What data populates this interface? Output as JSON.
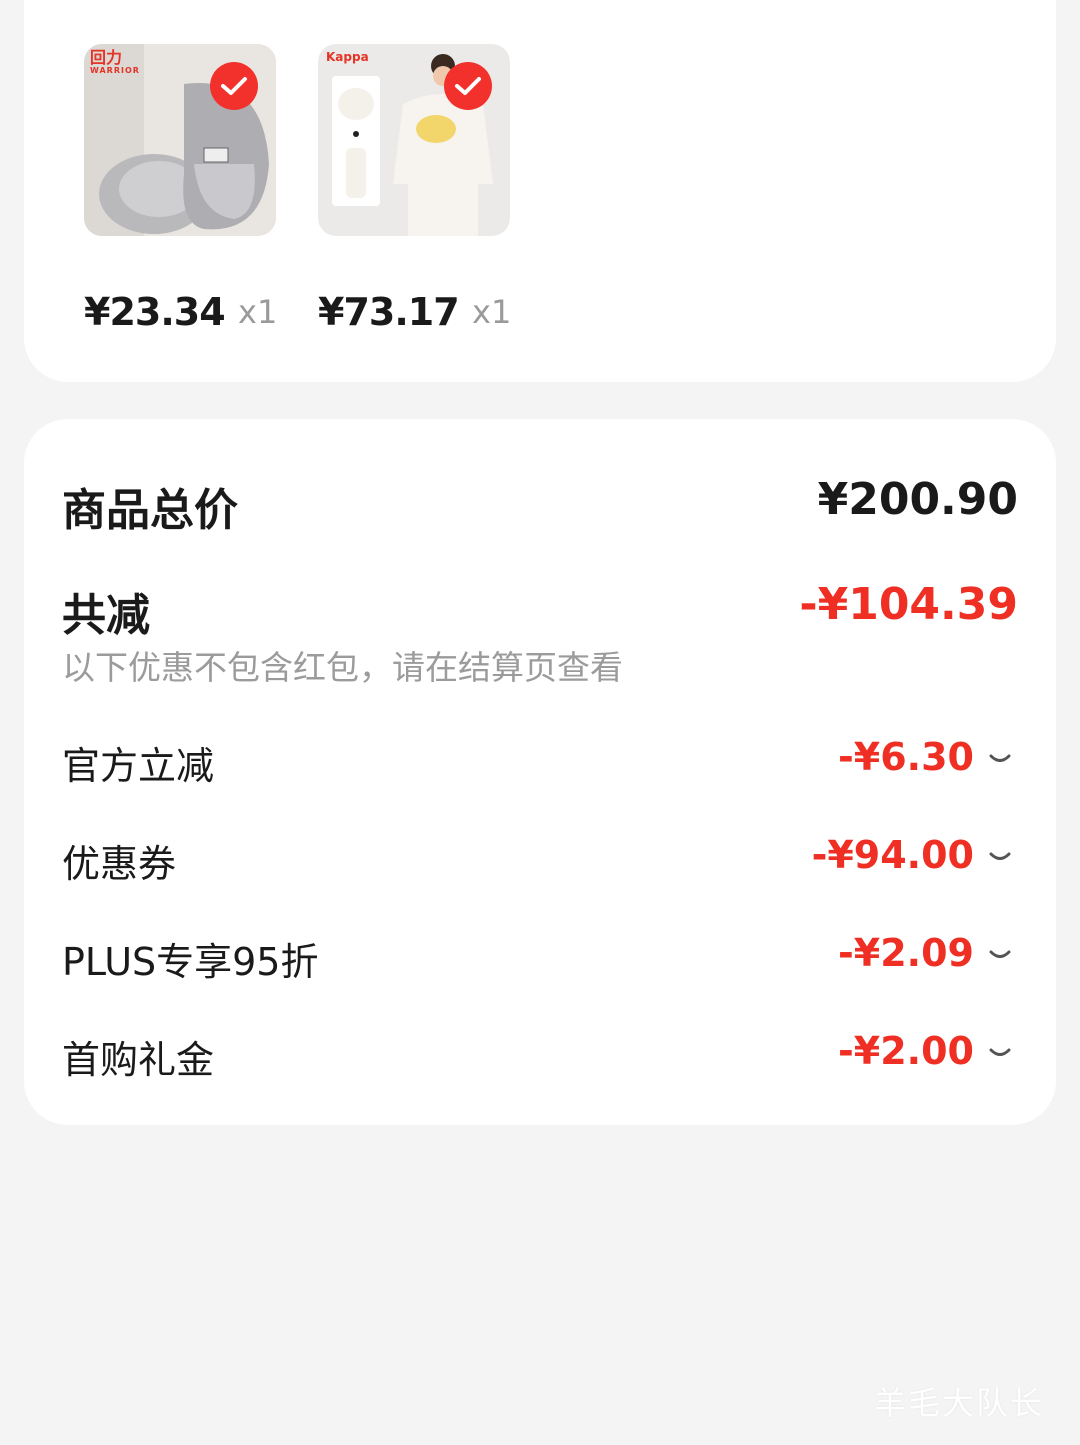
{
  "products": [
    {
      "brand_logo": "回力",
      "brand_sub": "WARRIOR",
      "price_int": "¥23",
      "price_dec": ".34",
      "qty": "x1"
    },
    {
      "brand_logo": "Kappa",
      "price_int": "¥73",
      "price_dec": ".17",
      "qty": "x1"
    }
  ],
  "summary": {
    "total_label": "商品总价",
    "total_value": "¥200.90",
    "reduce_label": "共减",
    "reduce_value": "-¥104.39",
    "note": "以下优惠不包含红包，请在结算页查看",
    "items": [
      {
        "label": "官方立减",
        "value": "-¥6.30"
      },
      {
        "label": "优惠券",
        "value": "-¥94.00"
      },
      {
        "label": "PLUS专享95折",
        "value": "-¥2.09"
      },
      {
        "label": "首购礼金",
        "value": "-¥2.00"
      }
    ]
  },
  "watermark": "羊毛大队长",
  "colors": {
    "accent": "#ef2f24",
    "check": "#f2312c"
  }
}
